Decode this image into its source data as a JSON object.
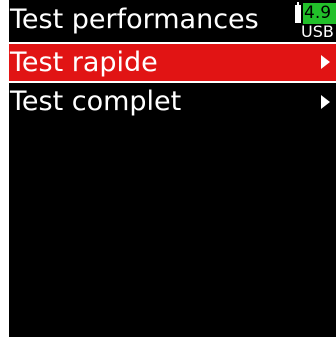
{
  "header": {
    "title": "Test performances",
    "battery": {
      "voltage": "4.9",
      "source": "USB",
      "icon": "battery-icon",
      "voltage_color": "#22c02a"
    }
  },
  "menu": {
    "items": [
      {
        "label": "Test rapide",
        "selected": true,
        "icon": "chevron-right-icon"
      },
      {
        "label": "Test complet",
        "selected": false,
        "icon": "chevron-right-icon"
      }
    ]
  },
  "colors": {
    "background": "#000000",
    "selection": "#e11414",
    "text": "#ffffff"
  }
}
